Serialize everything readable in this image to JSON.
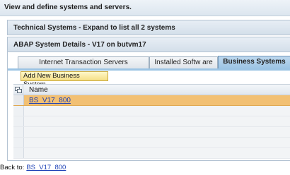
{
  "header": {
    "title": "View and define systems and servers."
  },
  "trays": {
    "technical_systems": "Technical Systems - Expand to list all 2 systems",
    "abap_details": "ABAP System Details - V17 on butvm17"
  },
  "tabs": [
    {
      "label": "Internet Transaction Servers",
      "active": false
    },
    {
      "label": "Installed Softw are",
      "active": false
    },
    {
      "label": "Business Systems",
      "active": true
    }
  ],
  "toolbar": {
    "add_label": "Add New Business System..."
  },
  "table": {
    "column_name": "Name",
    "rows": [
      "BS_V17_800",
      "",
      "",
      "",
      "",
      ""
    ],
    "selected_index": 0
  },
  "footer": {
    "back_label": "Back to:",
    "back_link": "BS_V17_800"
  },
  "colors": {
    "selected_row": "#f2c073",
    "active_tab": "#9cc4e4",
    "link": "#1a3fb5"
  }
}
